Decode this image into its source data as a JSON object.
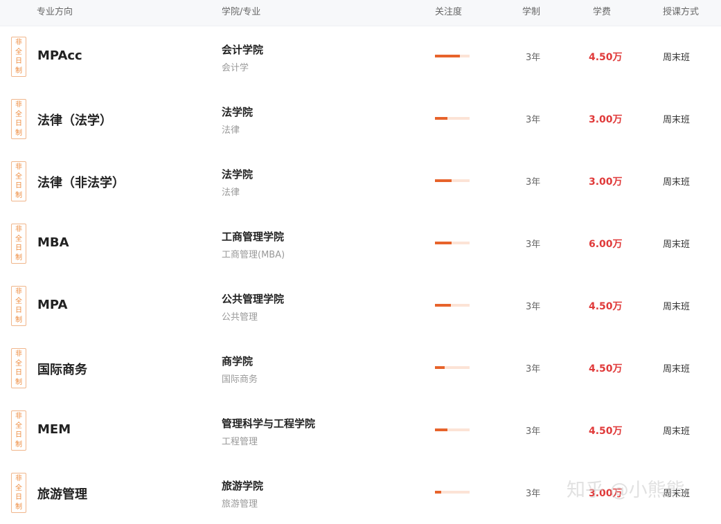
{
  "header": {
    "major_direction": "专业方向",
    "college_major": "学院/专业",
    "attention": "关注度",
    "duration": "学制",
    "tuition": "学费",
    "teaching_mode": "授课方式"
  },
  "rows": [
    {
      "tag": "非全日制",
      "major": "MPAcc",
      "college": "会计学院",
      "sub_major": "会计学",
      "attention": 0.72,
      "duration": "3年",
      "tuition": "4.50万",
      "mode": "周末班"
    },
    {
      "tag": "非全日制",
      "major": "法律（法学）",
      "college": "法学院",
      "sub_major": "法律",
      "attention": 0.36,
      "duration": "3年",
      "tuition": "3.00万",
      "mode": "周末班"
    },
    {
      "tag": "非全日制",
      "major": "法律（非法学）",
      "college": "法学院",
      "sub_major": "法律",
      "attention": 0.48,
      "duration": "3年",
      "tuition": "3.00万",
      "mode": "周末班"
    },
    {
      "tag": "非全日制",
      "major": "MBA",
      "college": "工商管理学院",
      "sub_major": "工商管理(MBA)",
      "attention": 0.48,
      "duration": "3年",
      "tuition": "6.00万",
      "mode": "周末班"
    },
    {
      "tag": "非全日制",
      "major": "MPA",
      "college": "公共管理学院",
      "sub_major": "公共管理",
      "attention": 0.46,
      "duration": "3年",
      "tuition": "4.50万",
      "mode": "周末班"
    },
    {
      "tag": "非全日制",
      "major": "国际商务",
      "college": "商学院",
      "sub_major": "国际商务",
      "attention": 0.28,
      "duration": "3年",
      "tuition": "4.50万",
      "mode": "周末班"
    },
    {
      "tag": "非全日制",
      "major": "MEM",
      "college": "管理科学与工程学院",
      "sub_major": "工程管理",
      "attention": 0.36,
      "duration": "3年",
      "tuition": "4.50万",
      "mode": "周末班"
    },
    {
      "tag": "非全日制",
      "major": "旅游管理",
      "college": "旅游学院",
      "sub_major": "旅游管理",
      "attention": 0.18,
      "duration": "3年",
      "tuition": "3.00万",
      "mode": "周末班"
    }
  ],
  "watermark": "知乎 @小熊熊",
  "colors": {
    "tag": "#ee8a3c",
    "tuition": "#e03a3a",
    "bar_fill": "#e7632b",
    "bar_track": "#fce3d6"
  }
}
